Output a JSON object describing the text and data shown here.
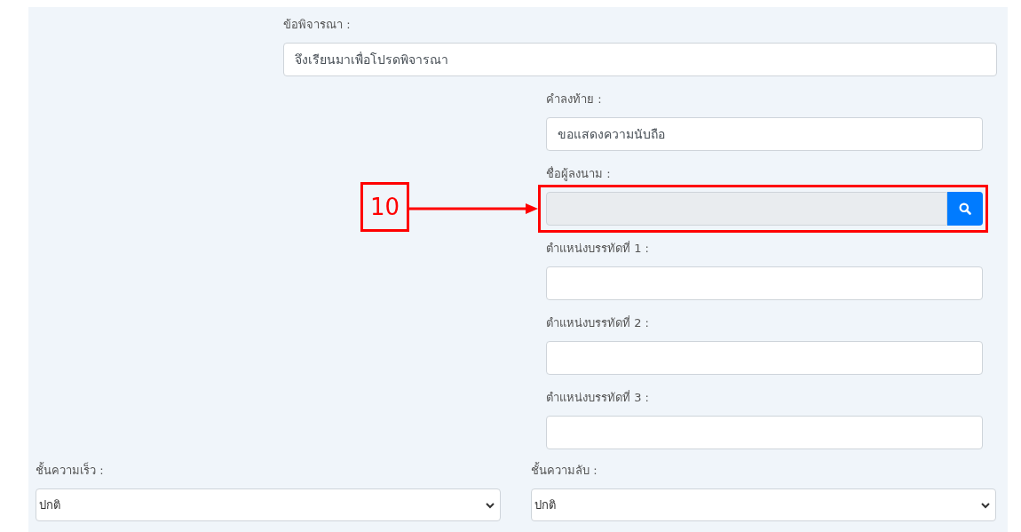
{
  "fields": [
    {
      "kind": "text",
      "label": "ข้อพิจารณา :",
      "value": "จึงเรียนมาเพื่อโปรดพิจารณา"
    },
    {
      "kind": "text",
      "label": "คำลงท้าย :",
      "value": "ขอแสดงความนับถือ"
    },
    {
      "kind": "search",
      "label": "ชื่อผู้ลงนาม :",
      "disabled": true
    },
    {
      "kind": "text",
      "label": "ตำแหน่งบรรทัดที่ 1 :"
    },
    {
      "kind": "text",
      "label": "ตำแหน่งบรรทัดที่ 2 :"
    },
    {
      "kind": "text",
      "label": "ตำแหน่งบรรทัดที่ 3 :"
    }
  ],
  "selects": [
    {
      "label": "ชั้นความเร็ว :",
      "value": "ปกติ"
    },
    {
      "label": "ชั้นความลับ :",
      "value": "ปกติ"
    }
  ],
  "annotation": {
    "number": "10"
  }
}
